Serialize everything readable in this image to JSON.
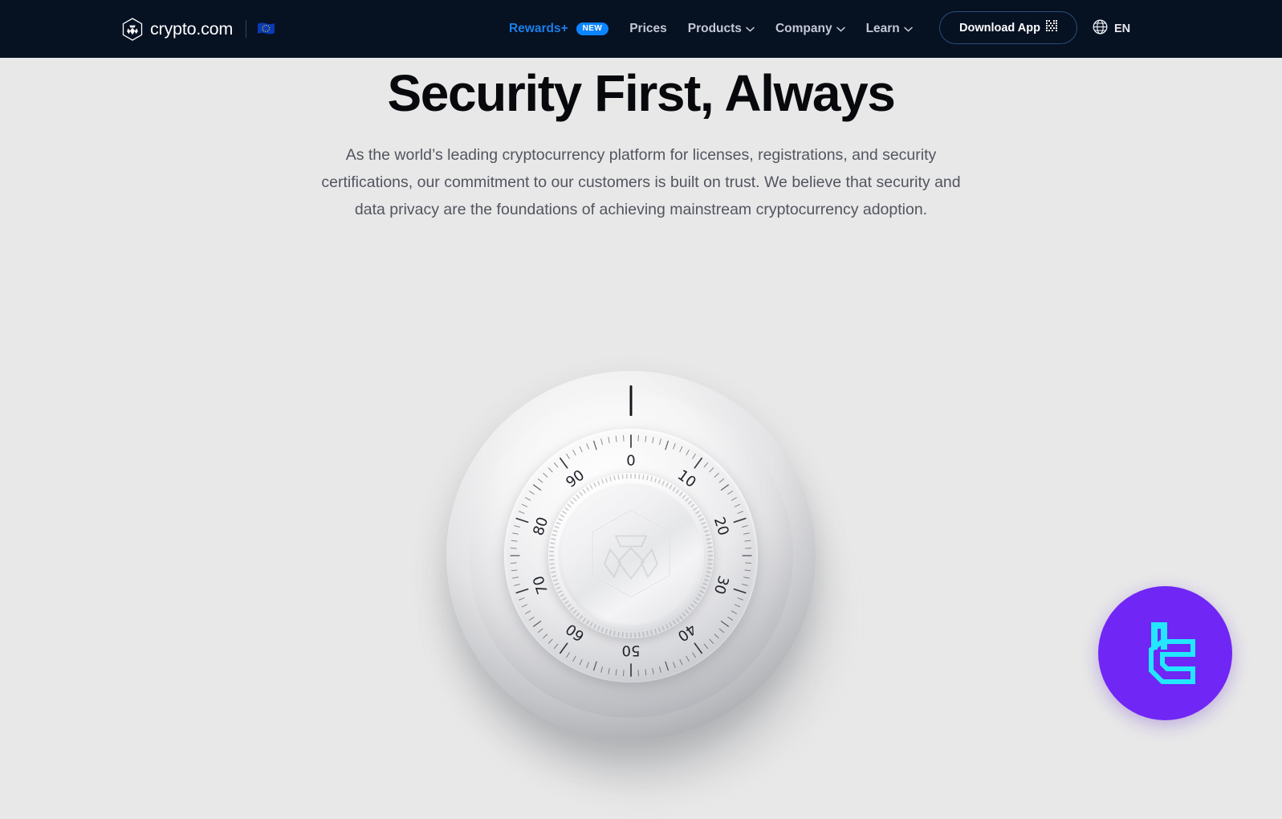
{
  "header": {
    "brand": {
      "name": "crypto.com",
      "logo_icon": "crypto-com-hexagon-logo",
      "region_flag_icon": "eu-flag"
    },
    "nav": [
      {
        "label": "Rewards+",
        "accent": true,
        "badge": "NEW",
        "chevron": false
      },
      {
        "label": "Prices",
        "accent": false,
        "chevron": false
      },
      {
        "label": "Products",
        "accent": false,
        "chevron": true
      },
      {
        "label": "Company",
        "accent": false,
        "chevron": true
      },
      {
        "label": "Learn",
        "accent": false,
        "chevron": true
      }
    ],
    "download_button": {
      "label": "Download App",
      "icon": "qr-code-icon"
    },
    "language": {
      "label": "EN",
      "icon": "globe-icon"
    },
    "colors": {
      "background": "#061122",
      "accent_blue": "#1a7fe8",
      "badge_blue": "#0a84ff"
    }
  },
  "hero": {
    "title": "Security First, Always",
    "subtitle": "As the world’s leading cryptocurrency platform for licenses, registrations, and security certifications, our commitment to our customers is built on trust. We believe that security and data privacy are the foundations of achieving mainstream cryptocurrency adoption."
  },
  "illustration": {
    "name": "safe-combination-dial",
    "dial_numbers": [
      "0",
      "10",
      "20",
      "30",
      "40",
      "50",
      "60",
      "70",
      "80",
      "90"
    ],
    "center_logo": "crypto-com-hexagon-logo",
    "indicator": "top-index-mark"
  },
  "floating_widget": {
    "name": "chat-widget",
    "icon": "cyan-bracket-logo",
    "colors": {
      "background": "#7026f5",
      "glyph": "#22e7ff"
    }
  },
  "page": {
    "background_color": "#e8e8e8",
    "text_color": "#52555f",
    "title_color": "#08090c"
  }
}
